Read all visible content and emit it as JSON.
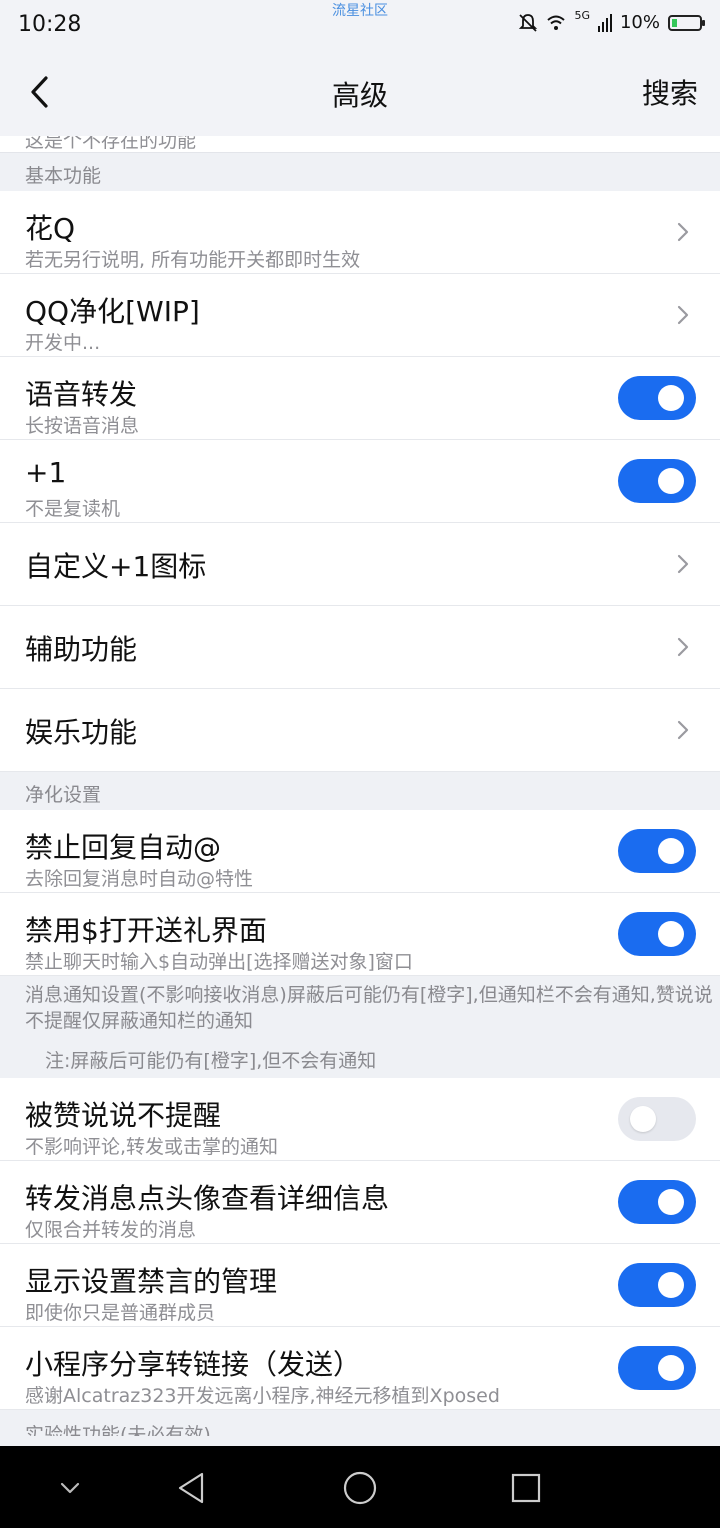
{
  "status_bar": {
    "time": "10:28",
    "center_text": "流星社区",
    "network": "5G",
    "battery": "10%",
    "battery_level": 0.1
  },
  "header": {
    "title": "高级",
    "search_label": "搜索",
    "back_icon": "chevron-left-icon"
  },
  "peek_text": "这是个不存在的功能",
  "sections": {
    "basic": "基本功能",
    "purify": "净化设置",
    "experimental": "实验性功能(未必有效)"
  },
  "basic_items": [
    {
      "title": "花Q",
      "subtitle": "若无另行说明, 所有功能开关都即时生效",
      "control": "chevron"
    },
    {
      "title": "QQ净化[WIP]",
      "subtitle": "开发中...",
      "control": "chevron"
    },
    {
      "title": "语音转发",
      "subtitle": "长按语音消息",
      "control": "toggle",
      "on": true
    },
    {
      "title": "+1",
      "subtitle": "不是复读机",
      "control": "toggle",
      "on": true
    },
    {
      "title": "自定义+1图标",
      "control": "chevron"
    },
    {
      "title": "辅助功能",
      "control": "chevron"
    },
    {
      "title": "娱乐功能",
      "control": "chevron"
    }
  ],
  "purify_items": [
    {
      "title": "禁止回复自动@",
      "subtitle": "去除回复消息时自动@特性",
      "control": "toggle",
      "on": true
    },
    {
      "title": "禁用$打开送礼界面",
      "subtitle": "禁止聊天时输入$自动弹出[选择赠送对象]窗口",
      "control": "toggle",
      "on": true
    }
  ],
  "notice": {
    "line1": "消息通知设置(不影响接收消息)屏蔽后可能仍有[橙字],但通知栏不会有通知,赞说说不提醒仅屏蔽通知栏的通知",
    "line2": "注:屏蔽后可能仍有[橙字],但不会有通知"
  },
  "notify_items": [
    {
      "title": "被赞说说不提醒",
      "subtitle": "不影响评论,转发或击掌的通知",
      "control": "toggle",
      "on": false
    },
    {
      "title": "转发消息点头像查看详细信息",
      "subtitle": "仅限合并转发的消息",
      "control": "toggle",
      "on": true
    },
    {
      "title": "显示设置禁言的管理",
      "subtitle": "即使你只是普通群成员",
      "control": "toggle",
      "on": true
    },
    {
      "title": "小程序分享转链接（发送）",
      "subtitle": "感谢Alcatraz323开发远离小程序,神经元移植到Xposed",
      "control": "toggle",
      "on": true
    }
  ],
  "colors": {
    "accent": "#1a6cf0",
    "toggle_off": "#e6e8ee",
    "background": "#eff1f5"
  },
  "nav_icons": [
    "chevron-down-icon",
    "back-triangle-icon",
    "home-circle-icon",
    "recents-square-icon"
  ]
}
